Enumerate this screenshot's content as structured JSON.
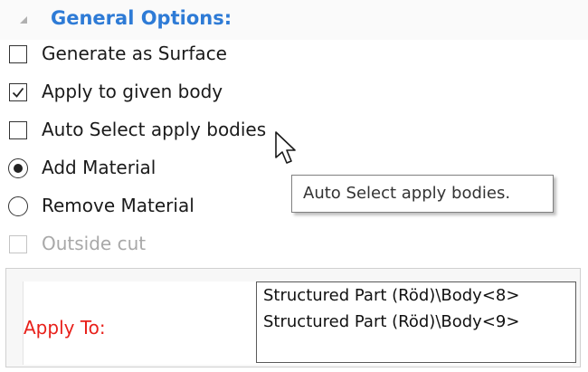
{
  "section": {
    "title": "General Options:",
    "arrow_icon": "collapse-triangle-icon"
  },
  "options": {
    "generate_surface": {
      "label": "Generate as Surface",
      "checked": false,
      "enabled": true
    },
    "apply_to_body": {
      "label": "Apply to given body",
      "checked": true,
      "enabled": true
    },
    "auto_select": {
      "label": "Auto Select apply bodies",
      "checked": false,
      "enabled": true
    },
    "add_material": {
      "label": "Add Material",
      "selected": true,
      "enabled": true
    },
    "remove_material": {
      "label": "Remove Material",
      "selected": false,
      "enabled": true
    },
    "outside_cut": {
      "label": "Outside cut",
      "checked": false,
      "enabled": false
    }
  },
  "tooltip": {
    "text": "Auto Select apply bodies."
  },
  "apply_to": {
    "label": "Apply To:",
    "label_color": "#e8201a",
    "items": [
      "Structured Part (Röd)\\Body<8>",
      "Structured Part (Röd)\\Body<9>"
    ]
  },
  "colors": {
    "section_title": "#2e7bd6",
    "disabled_text": "#a8a8a8"
  }
}
